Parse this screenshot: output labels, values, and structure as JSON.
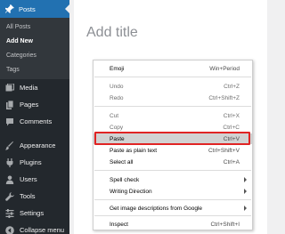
{
  "sidebar": {
    "posts": {
      "label": "Posts",
      "icon": "pushpin-icon"
    },
    "submenu": [
      "All Posts",
      "Add New",
      "Categories",
      "Tags"
    ],
    "items": [
      {
        "label": "Media",
        "icon": "media-icon"
      },
      {
        "label": "Pages",
        "icon": "pages-icon"
      },
      {
        "label": "Comments",
        "icon": "comments-icon"
      },
      {
        "label": "Appearance",
        "icon": "appearance-icon"
      },
      {
        "label": "Plugins",
        "icon": "plugins-icon"
      },
      {
        "label": "Users",
        "icon": "users-icon"
      },
      {
        "label": "Tools",
        "icon": "tools-icon"
      },
      {
        "label": "Settings",
        "icon": "settings-icon"
      },
      {
        "label": "Collapse menu",
        "icon": "collapse-icon"
      }
    ]
  },
  "editor": {
    "title_placeholder": "Add title"
  },
  "context_menu": {
    "emoji": {
      "label": "Emoji",
      "shortcut": "Win+Period"
    },
    "undo": {
      "label": "Undo",
      "shortcut": "Ctrl+Z"
    },
    "redo": {
      "label": "Redo",
      "shortcut": "Ctrl+Shift+Z"
    },
    "cut": {
      "label": "Cut",
      "shortcut": "Ctrl+X"
    },
    "copy": {
      "label": "Copy",
      "shortcut": "Ctrl+C"
    },
    "paste": {
      "label": "Paste",
      "shortcut": "Ctrl+V"
    },
    "paste_plain": {
      "label": "Paste as plain text",
      "shortcut": "Ctrl+Shift+V"
    },
    "select_all": {
      "label": "Select all",
      "shortcut": "Ctrl+A"
    },
    "spell_check": {
      "label": "Spell check"
    },
    "writing_direction": {
      "label": "Writing Direction"
    },
    "image_desc": {
      "label": "Get image descriptions from Google"
    },
    "inspect": {
      "label": "Inspect",
      "shortcut": "Ctrl+Shift+I"
    }
  },
  "colors": {
    "sidebar_bg": "#23282d",
    "active_bg": "#2271b1",
    "highlight_border": "#e02424"
  }
}
